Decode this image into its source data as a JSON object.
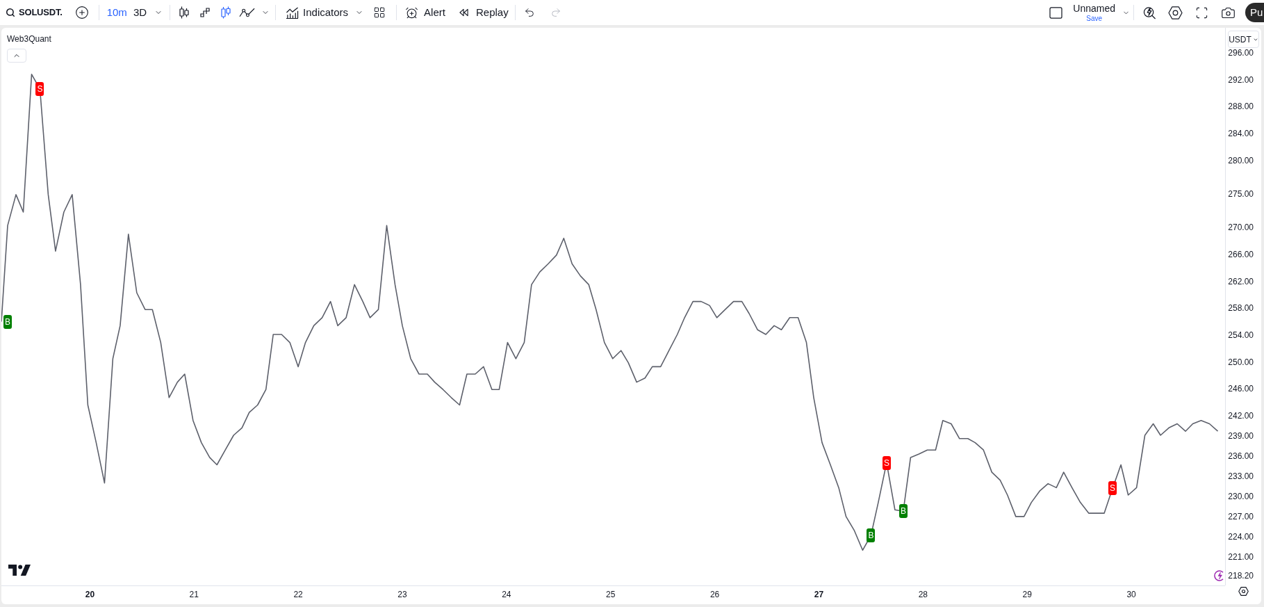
{
  "toolbar": {
    "symbol": "SOLUSDT.",
    "intervals": [
      {
        "label": "10m",
        "selected": true
      },
      {
        "label": "3D",
        "selected": false
      }
    ],
    "chart_styles": [
      {
        "kind": "candles",
        "selected": false
      },
      {
        "kind": "steps",
        "selected": false
      },
      {
        "kind": "hollow_candles",
        "selected": true
      },
      {
        "kind": "line_markers",
        "selected": false
      }
    ],
    "indicators": "Indicators",
    "alert": "Alert",
    "replay": "Replay",
    "undo": {
      "disabled": false
    },
    "redo": {
      "disabled": true
    },
    "layout": {
      "name": "Unnamed",
      "action": "Save"
    },
    "publish": "Pu"
  },
  "chart": {
    "legend": "Web3Quant",
    "currency": "USDT",
    "signal_tags": [
      {
        "color": "#008000"
      },
      {
        "color": "#ff0000"
      },
      {
        "color": "#008000"
      },
      {
        "color": "#ff0000"
      },
      {
        "color": "#008000"
      },
      {
        "color": "#ff0000"
      }
    ],
    "time_axis_ticks": [
      {
        "major": true
      },
      {
        "major": false
      },
      {
        "major": false
      },
      {
        "major": false
      },
      {
        "major": false
      },
      {
        "major": false
      },
      {
        "major": false
      },
      {
        "major": true
      },
      {
        "major": false
      },
      {
        "major": false
      },
      {
        "major": false
      }
    ],
    "chart_data": {
      "type": "line",
      "xlim": [
        19.15,
        30.9
      ],
      "ylim": [
        216.75,
        299.72
      ],
      "x": [
        19.15,
        19.21,
        19.29,
        19.36,
        19.44,
        19.52,
        19.6,
        19.67,
        19.75,
        19.83,
        19.91,
        19.98,
        20.06,
        20.14,
        20.22,
        20.29,
        20.37,
        20.45,
        20.53,
        20.6,
        20.68,
        20.76,
        20.84,
        20.91,
        20.99,
        21.07,
        21.15,
        21.22,
        21.3,
        21.38,
        21.46,
        21.53,
        21.61,
        21.69,
        21.76,
        21.84,
        21.92,
        22.0,
        22.07,
        22.15,
        22.23,
        22.31,
        22.38,
        22.46,
        22.54,
        22.62,
        22.69,
        22.77,
        22.85,
        22.93,
        23.0,
        23.08,
        23.16,
        23.24,
        23.31,
        23.39,
        23.47,
        23.55,
        23.62,
        23.7,
        23.78,
        23.86,
        23.93,
        24.01,
        24.09,
        24.17,
        24.24,
        24.32,
        24.4,
        24.48,
        24.55,
        24.63,
        24.71,
        24.79,
        24.86,
        24.94,
        25.02,
        25.1,
        25.17,
        25.25,
        25.33,
        25.4,
        25.48,
        25.56,
        25.64,
        25.71,
        25.79,
        25.87,
        25.95,
        26.02,
        26.1,
        26.18,
        26.26,
        26.33,
        26.41,
        26.49,
        26.57,
        26.64,
        26.72,
        26.8,
        26.88,
        26.95,
        27.03,
        27.11,
        27.19,
        27.26,
        27.34,
        27.42,
        27.5,
        27.57,
        27.65,
        27.73,
        27.81,
        27.88,
        27.96,
        28.04,
        28.12,
        28.19,
        28.27,
        28.35,
        28.43,
        28.5,
        28.58,
        28.66,
        28.74,
        28.81,
        28.89,
        28.97,
        29.04,
        29.12,
        29.2,
        29.28,
        29.35,
        29.43,
        29.51,
        29.59,
        29.66,
        29.74,
        29.82,
        29.9,
        29.97,
        30.05,
        30.13,
        30.21,
        30.28,
        30.36,
        30.44,
        30.52,
        30.59,
        30.67,
        30.75,
        30.83
      ],
      "series": [
        {
          "color": "#5d606b",
          "values": [
            256.0,
            270.3,
            274.9,
            272.3,
            292.8,
            290.6,
            274.9,
            266.5,
            272.3,
            274.9,
            261.5,
            243.6,
            238.0,
            232.0,
            250.5,
            255.4,
            269.0,
            260.3,
            257.8,
            257.8,
            252.9,
            244.7,
            247.0,
            248.2,
            241.3,
            238.0,
            235.8,
            234.7,
            236.9,
            239.1,
            240.2,
            242.5,
            243.6,
            245.9,
            254.1,
            254.1,
            252.9,
            249.3,
            252.9,
            255.4,
            256.6,
            259.0,
            255.4,
            256.6,
            261.5,
            259.0,
            256.6,
            257.8,
            270.3,
            261.5,
            255.4,
            250.5,
            248.2,
            248.2,
            247.0,
            245.9,
            244.7,
            243.6,
            248.2,
            248.2,
            249.3,
            245.9,
            245.9,
            252.9,
            250.5,
            252.9,
            261.5,
            263.4,
            264.6,
            265.9,
            268.4,
            264.6,
            262.8,
            261.5,
            257.8,
            252.9,
            250.5,
            251.7,
            249.9,
            247.0,
            247.6,
            249.3,
            249.3,
            251.7,
            254.1,
            256.6,
            259.0,
            259.0,
            258.4,
            256.6,
            257.8,
            259.0,
            259.0,
            257.2,
            254.8,
            254.1,
            255.4,
            254.8,
            256.6,
            256.6,
            252.9,
            244.7,
            238.0,
            234.7,
            231.3,
            227.0,
            224.9,
            222.0,
            224.2,
            229.1,
            235.0,
            228.0,
            227.8,
            235.8,
            236.3,
            236.9,
            236.9,
            241.3,
            240.8,
            238.6,
            238.6,
            238.0,
            236.9,
            233.6,
            232.4,
            230.2,
            227.0,
            227.0,
            229.1,
            230.8,
            231.9,
            231.3,
            233.6,
            231.3,
            229.1,
            227.5,
            227.5,
            227.5,
            231.2,
            234.7,
            230.2,
            231.3,
            239.1,
            240.8,
            239.1,
            240.2,
            240.8,
            239.7,
            240.8,
            241.3,
            240.8,
            239.7
          ]
        }
      ],
      "xticks": [
        {
          "value": 20,
          "label": "20"
        },
        {
          "value": 21,
          "label": "21"
        },
        {
          "value": 22,
          "label": "22"
        },
        {
          "value": 23,
          "label": "23"
        },
        {
          "value": 24,
          "label": "24"
        },
        {
          "value": 25,
          "label": "25"
        },
        {
          "value": 26,
          "label": "26"
        },
        {
          "value": 27,
          "label": "27"
        },
        {
          "value": 28,
          "label": "28"
        },
        {
          "value": 29,
          "label": "29"
        },
        {
          "value": 30,
          "label": "30"
        }
      ],
      "yticks": [
        {
          "value": 296,
          "label": "296.00"
        },
        {
          "value": 292,
          "label": "292.00"
        },
        {
          "value": 288,
          "label": "288.00"
        },
        {
          "value": 284,
          "label": "284.00"
        },
        {
          "value": 280,
          "label": "280.00"
        },
        {
          "value": 275,
          "label": "275.00"
        },
        {
          "value": 270,
          "label": "270.00"
        },
        {
          "value": 266,
          "label": "266.00"
        },
        {
          "value": 262,
          "label": "262.00"
        },
        {
          "value": 258,
          "label": "258.00"
        },
        {
          "value": 254,
          "label": "254.00"
        },
        {
          "value": 250,
          "label": "250.00"
        },
        {
          "value": 246,
          "label": "246.00"
        },
        {
          "value": 242,
          "label": "242.00"
        },
        {
          "value": 239,
          "label": "239.00"
        },
        {
          "value": 236,
          "label": "236.00"
        },
        {
          "value": 233,
          "label": "233.00"
        },
        {
          "value": 230,
          "label": "230.00"
        },
        {
          "value": 227,
          "label": "227.00"
        },
        {
          "value": 224,
          "label": "224.00"
        },
        {
          "value": 221,
          "label": "221.00"
        },
        {
          "value": 218.2,
          "label": "218.20"
        }
      ],
      "annotations": [
        {
          "x": 19.15,
          "y": 256.0,
          "text": "B"
        },
        {
          "x": 19.52,
          "y": 290.6,
          "text": "S"
        },
        {
          "x": 27.5,
          "y": 224.2,
          "text": "B"
        },
        {
          "x": 27.65,
          "y": 235.0,
          "text": "S"
        },
        {
          "x": 27.81,
          "y": 227.8,
          "text": "B"
        },
        {
          "x": 29.82,
          "y": 231.2,
          "text": "S"
        }
      ]
    }
  }
}
